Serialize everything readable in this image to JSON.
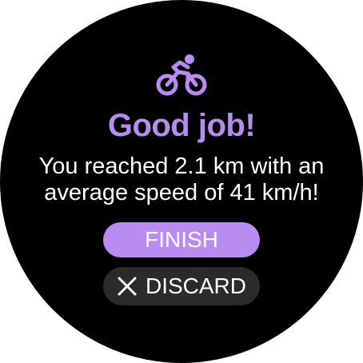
{
  "colors": {
    "accent": "#b88cf0",
    "background": "#000000",
    "discard_bg": "#2b2b2e",
    "text": "#ffffff"
  },
  "icon": {
    "name": "bike-icon"
  },
  "summary": {
    "title": "Good job!",
    "message": "You reached 2.1 km with an average speed of 41 km/h!"
  },
  "actions": {
    "finish_label": "FINISH",
    "discard_label": "DISCARD",
    "discard_icon": "close-icon"
  }
}
